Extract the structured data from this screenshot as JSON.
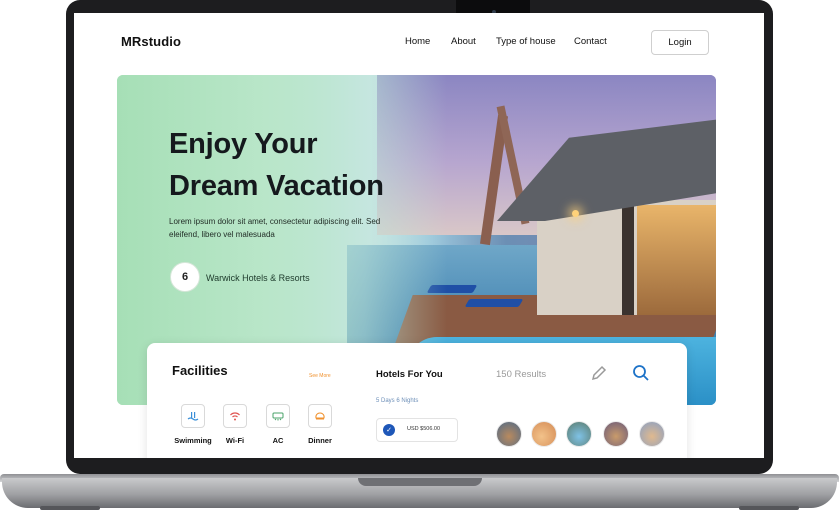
{
  "header": {
    "brand": "MRstudio",
    "nav": [
      "Home",
      "About",
      "Type of house",
      "Contact"
    ],
    "login_label": "Login"
  },
  "hero": {
    "title": "Enjoy Your\nDream Vacation",
    "description": "Lorem ipsum dolor sit amet, consectetur adipiscing elit. Sed eleifend, libero vel malesuada",
    "badge_glyph": "6",
    "brand_name": "Warwick Hotels & Resorts"
  },
  "facilities": {
    "title": "Facilities",
    "see_more": "See More",
    "items": [
      {
        "label": "Swimming",
        "icon": "pool-icon",
        "color": "#3a8fd8"
      },
      {
        "label": "Wi-Fi",
        "icon": "wifi-icon",
        "color": "#e0524f"
      },
      {
        "label": "AC",
        "icon": "ac-icon",
        "color": "#4aa36a"
      },
      {
        "label": "Dinner",
        "icon": "dinner-icon",
        "color": "#f0922f"
      }
    ]
  },
  "hotels": {
    "title": "Hotels For You",
    "results": "150 Results",
    "nights": "5 Days 6 Nights",
    "price": "USD $506.00",
    "avatars": 5
  },
  "colors": {
    "accent_blue": "#1e73c8",
    "check_blue": "#1e57b8",
    "see_more_orange": "#f0922f",
    "hero_green": "#a8e1b9"
  }
}
